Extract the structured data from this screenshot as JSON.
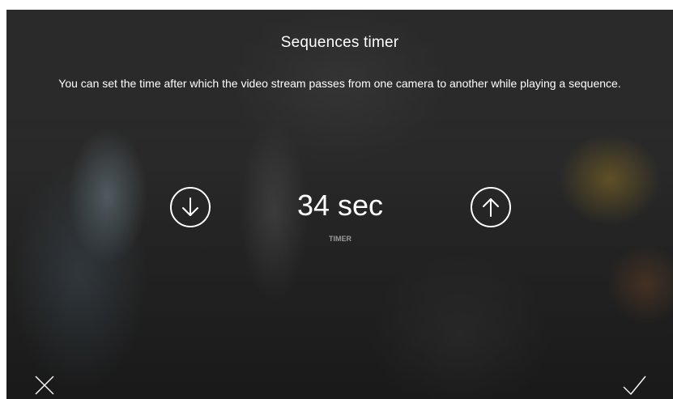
{
  "dialog": {
    "title": "Sequences timer",
    "description": "You can set the time after which the video stream passes from one camera to another while playing a sequence."
  },
  "timer": {
    "value_display": "34 sec",
    "value_seconds": 34,
    "label": "TIMER"
  },
  "controls": {
    "decrease_icon": "arrow-down-circle-icon",
    "increase_icon": "arrow-up-circle-icon",
    "cancel_icon": "close-icon",
    "confirm_icon": "check-icon"
  },
  "colors": {
    "text": "#ffffff",
    "label": "#9a9a9a",
    "background": "#2b2b2b"
  }
}
